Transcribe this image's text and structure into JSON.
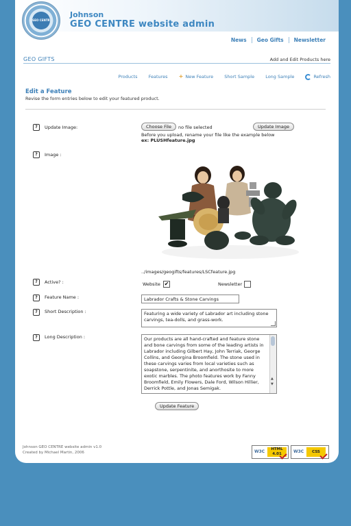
{
  "header": {
    "org": "Johnson",
    "title": "GEO CENTRE website admin",
    "logo_text": "GEO CENTRE"
  },
  "topnav": [
    "News",
    "Geo Gifts",
    "Newsletter"
  ],
  "section": {
    "title": "GEO GIFTS",
    "subtitle": "Add and Edit Products here"
  },
  "subnav": {
    "products": "Products",
    "features": "Features",
    "new_feature": "New Feature",
    "short_sample": "Short Sample",
    "long_sample": "Long Sample",
    "refresh": "Refresh"
  },
  "form": {
    "heading": "Edit a Feature",
    "instructions": "Revise the form entries below to edit your featured product.",
    "help_glyph": "?",
    "update_image": {
      "label": "Update Image:",
      "choose_file": "Choose File",
      "file_status": "no file selected",
      "button": "Update Image",
      "note": "Before you upload, rename your file like the example below",
      "example": "ex: PLUSHfeature.jpg"
    },
    "image": {
      "label": "Image :",
      "path": "../images/geogifts/features/LSCfeature.jpg"
    },
    "active": {
      "label": "Active? :",
      "website_label": "Website",
      "website_checked": true,
      "newsletter_label": "Newsletter",
      "newsletter_checked": false,
      "check_glyph": "✔"
    },
    "feature_name": {
      "label": "Feature Name :",
      "value": "Labrador Crafts & Stone Carvings"
    },
    "short_description": {
      "label": "Short Description :",
      "value": "Featuring a wide variety of Labrador art including stone carvings, tea-dolls, and grass-work."
    },
    "long_description": {
      "label": "Long Description :",
      "value": "Our products are all hand-crafted and feature stone and bone carvings from some of the leading artists in Labrador including Gilbert Hay, John Terriak, George Collins, and Georgina Broomfield.  The stone used in these carvings varies from local varieties such as soapstone, serpentinite, and anorthosite to more exotic marbles.  The photo features work by Fanny Broomfield, Emily Flowers, Dale Ford, Wilson Hillier, Derrick Pottle, and Jonas Semigak."
    },
    "submit": "Update Feature"
  },
  "footer": {
    "line1": "Johnson GEO CENTRE website admin v1.0",
    "line2": "Created by Michael Martin, 2006"
  },
  "badges": {
    "w3c": "W3C",
    "html": "HTML 4.01",
    "css": "CSS"
  }
}
